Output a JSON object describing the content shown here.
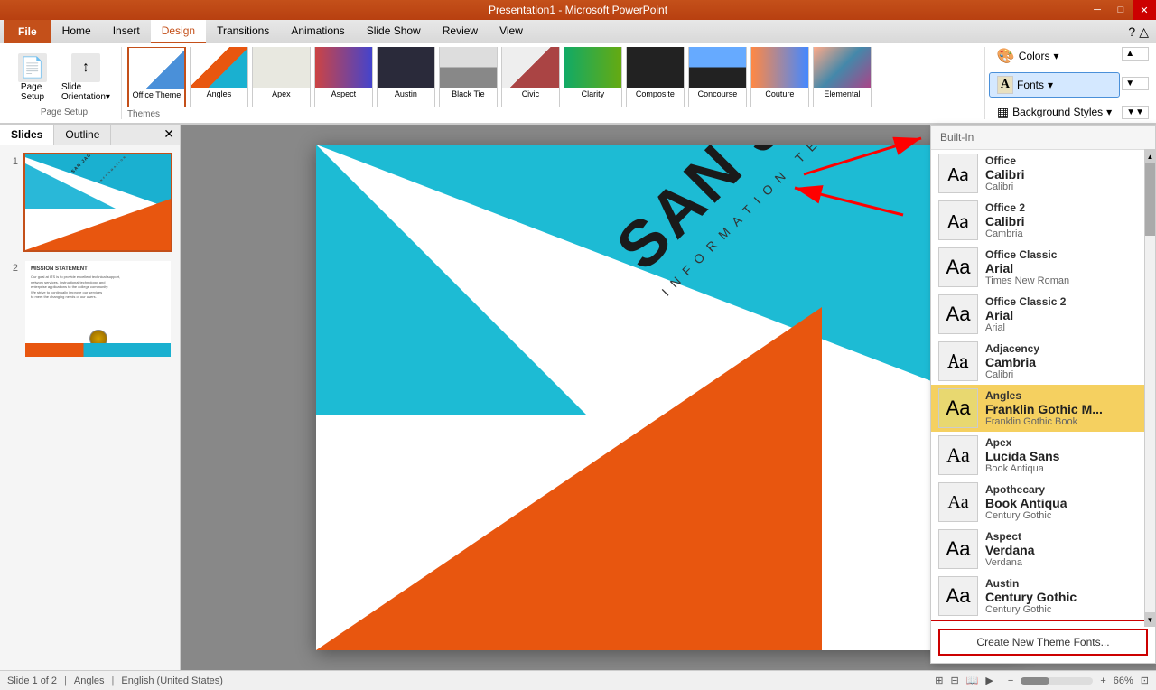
{
  "titlebar": {
    "title": "Presentation1 - Microsoft PowerPoint",
    "min_btn": "─",
    "max_btn": "□",
    "close_btn": "✕"
  },
  "ribbon": {
    "tabs": [
      {
        "id": "file",
        "label": "File",
        "active": false
      },
      {
        "id": "home",
        "label": "Home",
        "active": false
      },
      {
        "id": "insert",
        "label": "Insert",
        "active": false
      },
      {
        "id": "design",
        "label": "Design",
        "active": true
      },
      {
        "id": "transitions",
        "label": "Transitions",
        "active": false
      },
      {
        "id": "animations",
        "label": "Animations",
        "active": false
      },
      {
        "id": "slideshow",
        "label": "Slide Show",
        "active": false
      },
      {
        "id": "review",
        "label": "Review",
        "active": false
      },
      {
        "id": "view",
        "label": "View",
        "active": false
      }
    ],
    "design_group": {
      "page_setup_label": "Page Setup",
      "themes_label": "Themes",
      "colors_label": "Colors",
      "fonts_label": "Fonts",
      "background_styles_label": "Background Styles"
    }
  },
  "slides_panel": {
    "tabs": [
      "Slides",
      "Outline"
    ],
    "active_tab": "Slides",
    "slide1_num": "1",
    "slide2_num": "2"
  },
  "main_slide": {
    "title": "SAN JACINTO COLLEGE",
    "subtitle": "INFORMATION TECHNOLOGY SERVICES"
  },
  "fonts_panel": {
    "section_label": "Built-In",
    "items": [
      {
        "name": "Office",
        "heading": "Calibri",
        "body": "Calibri",
        "selected": false,
        "preview": "Aa"
      },
      {
        "name": "Office 2",
        "heading": "Calibri",
        "body": "Cambria",
        "selected": false,
        "preview": "Aa"
      },
      {
        "name": "Office Classic",
        "heading": "Arial",
        "body": "Times New Roman",
        "selected": false,
        "preview": "Aa"
      },
      {
        "name": "Office Classic 2",
        "heading": "Arial",
        "body": "Arial",
        "selected": false,
        "preview": "Aa"
      },
      {
        "name": "Adjacency",
        "heading": "Cambria",
        "body": "Calibri",
        "selected": false,
        "preview": "Aa"
      },
      {
        "name": "Angles",
        "heading": "Franklin Gothic M...",
        "body": "Franklin Gothic Book",
        "selected": true,
        "preview": "Aa"
      },
      {
        "name": "Apex",
        "heading": "Lucida Sans",
        "body": "Book Antiqua",
        "selected": false,
        "preview": "Aa"
      },
      {
        "name": "Apothecary",
        "heading": "Book Antiqua",
        "body": "Century Gothic",
        "selected": false,
        "preview": "Aa"
      },
      {
        "name": "Aspect",
        "heading": "Verdana",
        "body": "Verdana",
        "selected": false,
        "preview": "Aa"
      },
      {
        "name": "Austin",
        "heading": "Century Gothic",
        "body": "Century Gothic",
        "selected": false,
        "preview": "Aa"
      }
    ],
    "footer_btn": "Create New Theme Fonts..."
  },
  "status_bar": {
    "slide_info": "Slide 1 of 2",
    "theme": "Angles",
    "language": "English (United States)"
  },
  "themes": [
    {
      "id": "t1",
      "name": "Office Theme",
      "selected": true
    },
    {
      "id": "t2",
      "name": "Angles",
      "selected": false
    },
    {
      "id": "t3",
      "name": "Apex",
      "selected": false
    },
    {
      "id": "t4",
      "name": "Aspect",
      "selected": false
    },
    {
      "id": "t5",
      "name": "Austin",
      "selected": false
    },
    {
      "id": "t6",
      "name": "Black Tie",
      "selected": false
    },
    {
      "id": "t7",
      "name": "Civic",
      "selected": false
    },
    {
      "id": "t8",
      "name": "Clarity",
      "selected": false
    },
    {
      "id": "t9",
      "name": "Composite",
      "selected": false
    },
    {
      "id": "t10",
      "name": "Concourse",
      "selected": false
    },
    {
      "id": "t11",
      "name": "Couture",
      "selected": false
    },
    {
      "id": "t12",
      "name": "Elemental",
      "selected": false
    }
  ]
}
